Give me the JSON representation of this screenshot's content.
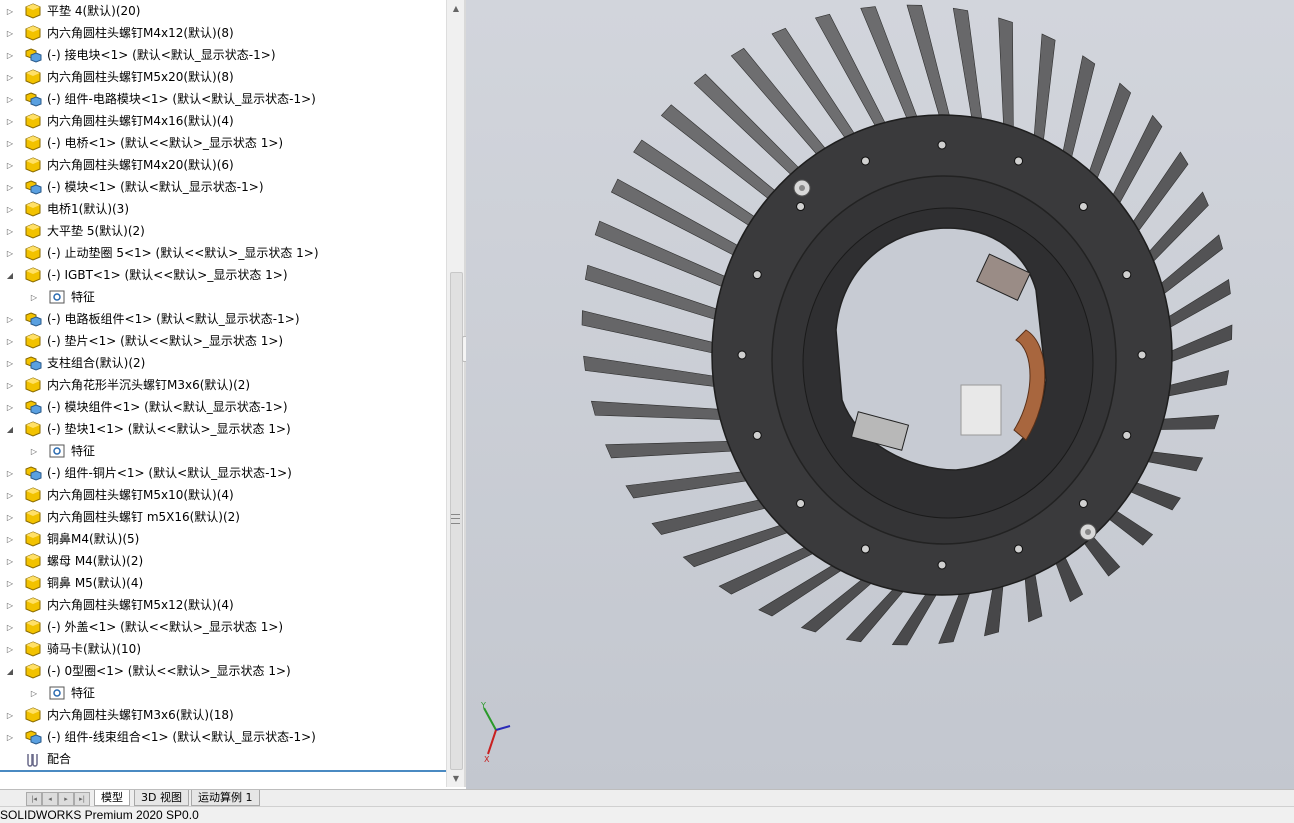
{
  "tree": {
    "items": [
      {
        "label": "平垫 4(默认)(20)",
        "icon": "part-icon",
        "expanded": false
      },
      {
        "label": "内六角圆柱头螺钉M4x12(默认)(8)",
        "icon": "part-icon",
        "expanded": false
      },
      {
        "label": "(-) 接电块<1> (默认<默认_显示状态-1>)",
        "icon": "assembly-icon",
        "expanded": false
      },
      {
        "label": "内六角圆柱头螺钉M5x20(默认)(8)",
        "icon": "part-icon",
        "expanded": false
      },
      {
        "label": "(-) 组件-电路模块<1> (默认<默认_显示状态-1>)",
        "icon": "assembly-icon",
        "expanded": false
      },
      {
        "label": "内六角圆柱头螺钉M4x16(默认)(4)",
        "icon": "part-icon",
        "expanded": false
      },
      {
        "label": "(-) 电桥<1> (默认<<默认>_显示状态 1>)",
        "icon": "part-icon",
        "expanded": false
      },
      {
        "label": "内六角圆柱头螺钉M4x20(默认)(6)",
        "icon": "part-icon",
        "expanded": false
      },
      {
        "label": "(-) 模块<1> (默认<默认_显示状态-1>)",
        "icon": "assembly-icon",
        "expanded": false
      },
      {
        "label": "电桥1(默认)(3)",
        "icon": "part-icon",
        "expanded": false
      },
      {
        "label": "大平垫 5(默认)(2)",
        "icon": "part-icon",
        "expanded": false
      },
      {
        "label": "(-) 止动垫圈 5<1> (默认<<默认>_显示状态 1>)",
        "icon": "part-icon",
        "expanded": false
      },
      {
        "label": "(-) IGBT<1> (默认<<默认>_显示状态 1>)",
        "icon": "part-icon",
        "expanded": true
      },
      {
        "label": "特征",
        "icon": "features-folder-icon",
        "child": true
      },
      {
        "label": "(-) 电路板组件<1> (默认<默认_显示状态-1>)",
        "icon": "assembly-icon",
        "expanded": false
      },
      {
        "label": "(-) 垫片<1> (默认<<默认>_显示状态 1>)",
        "icon": "part-icon",
        "expanded": false
      },
      {
        "label": "支柱组合(默认)(2)",
        "icon": "assembly-icon",
        "expanded": false
      },
      {
        "label": "内六角花形半沉头螺钉M3x6(默认)(2)",
        "icon": "part-icon",
        "expanded": false
      },
      {
        "label": "(-) 模块组件<1> (默认<默认_显示状态-1>)",
        "icon": "assembly-icon",
        "expanded": false
      },
      {
        "label": "(-) 垫块1<1> (默认<<默认>_显示状态 1>)",
        "icon": "part-icon",
        "expanded": true
      },
      {
        "label": "特征",
        "icon": "features-folder-icon",
        "child": true
      },
      {
        "label": "(-) 组件-铜片<1> (默认<默认_显示状态-1>)",
        "icon": "assembly-icon",
        "expanded": false
      },
      {
        "label": "内六角圆柱头螺钉M5x10(默认)(4)",
        "icon": "part-icon",
        "expanded": false
      },
      {
        "label": "内六角圆柱头螺钉 m5X16(默认)(2)",
        "icon": "part-icon",
        "expanded": false
      },
      {
        "label": "铜鼻M4(默认)(5)",
        "icon": "part-icon",
        "expanded": false
      },
      {
        "label": "螺母 M4(默认)(2)",
        "icon": "part-icon",
        "expanded": false
      },
      {
        "label": "铜鼻 M5(默认)(4)",
        "icon": "part-icon",
        "expanded": false
      },
      {
        "label": "内六角圆柱头螺钉M5x12(默认)(4)",
        "icon": "part-icon",
        "expanded": false
      },
      {
        "label": "(-) 外盖<1> (默认<<默认>_显示状态 1>)",
        "icon": "part-icon",
        "expanded": false
      },
      {
        "label": "骑马卡(默认)(10)",
        "icon": "part-icon",
        "expanded": false
      },
      {
        "label": "(-) 0型圈<1> (默认<<默认>_显示状态 1>)",
        "icon": "part-icon",
        "expanded": true
      },
      {
        "label": "特征",
        "icon": "features-folder-icon",
        "child": true
      },
      {
        "label": "内六角圆柱头螺钉M3x6(默认)(18)",
        "icon": "part-icon",
        "expanded": false
      },
      {
        "label": "(-) 组件-线束组合<1> (默认<默认_显示状态-1>)",
        "icon": "assembly-icon",
        "expanded": false
      },
      {
        "label": "配合",
        "icon": "mates-icon",
        "noarrow": true
      }
    ]
  },
  "tabs": [
    {
      "label": "模型",
      "active": true
    },
    {
      "label": "3D 视图",
      "active": false
    },
    {
      "label": "运动算例 1",
      "active": false
    }
  ],
  "status": {
    "text": "SOLIDWORKS Premium 2020 SP0.0"
  },
  "triad": {
    "x_label": "X",
    "y_label": "Y"
  },
  "colors": {
    "accent": "#4a8ac2",
    "viewport_bg": "#c8ccd4",
    "part_icon": "#e8b400"
  }
}
